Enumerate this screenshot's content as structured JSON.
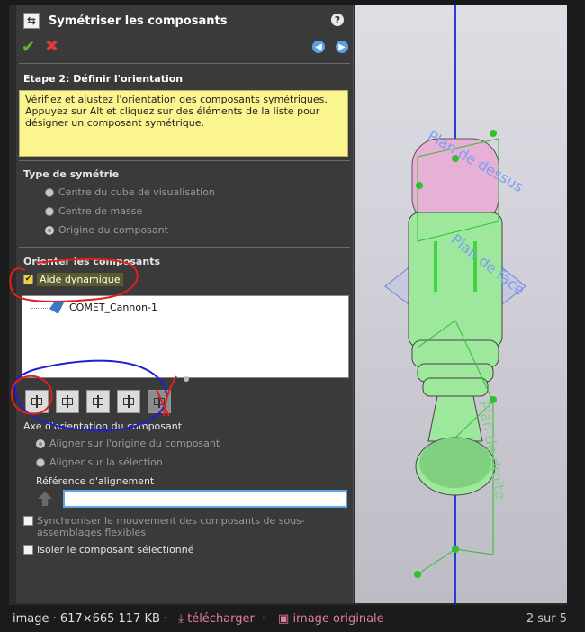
{
  "panel": {
    "title": "Symétriser les composants",
    "help_icon": "?",
    "step_title": "Etape 2: Définir l'orientation",
    "note": "Vérifiez et ajustez l'orientation des composants symétriques. Appuyez sur Alt et cliquez sur des éléments de la liste pour désigner un composant symétrique.",
    "symmetry_group": {
      "title": "Type de symétrie",
      "options": [
        "Centre du cube de visualisation",
        "Centre de masse",
        "Origine du composant"
      ],
      "selected": "Origine du composant"
    },
    "orient_group": {
      "title": "Orienter les composants",
      "dynamic_help_label": "Aide dynamique",
      "dynamic_help_checked": true,
      "components": [
        "COMET_Cannon-1"
      ]
    },
    "axis_group": {
      "title": "Axe d'orientation du composant",
      "options": [
        "Aligner sur l'origine du composant",
        "Aligner sur la sélection"
      ],
      "selected": "Aligner sur l'origine du composant"
    },
    "alignment_ref": {
      "label": "Référence d'alignement",
      "value": ""
    },
    "sync_label": "Synchroniser le mouvement des composants de sous-assemblages flexibles",
    "isolate_label": "Isoler le composant sélectionné"
  },
  "viewport": {
    "planes": [
      "Plan de dessus",
      "Plan de face",
      "Plan de droite"
    ]
  },
  "footer": {
    "info": "image · 617×665 117 KB ·",
    "download": "télécharger",
    "original": "image originale",
    "pager": "2 sur 5"
  },
  "icons": {
    "ok": "check-icon",
    "cancel": "x-icon",
    "prev": "arrow-left-icon",
    "next": "arrow-right-icon"
  },
  "colors": {
    "note_bg": "#fbf58f",
    "accent_blue": "#5aa2e6",
    "annotation_red": "#e02020",
    "annotation_blue": "#1f1fd0",
    "model_green": "#8fe38f",
    "model_pink": "#e9b6d8"
  }
}
